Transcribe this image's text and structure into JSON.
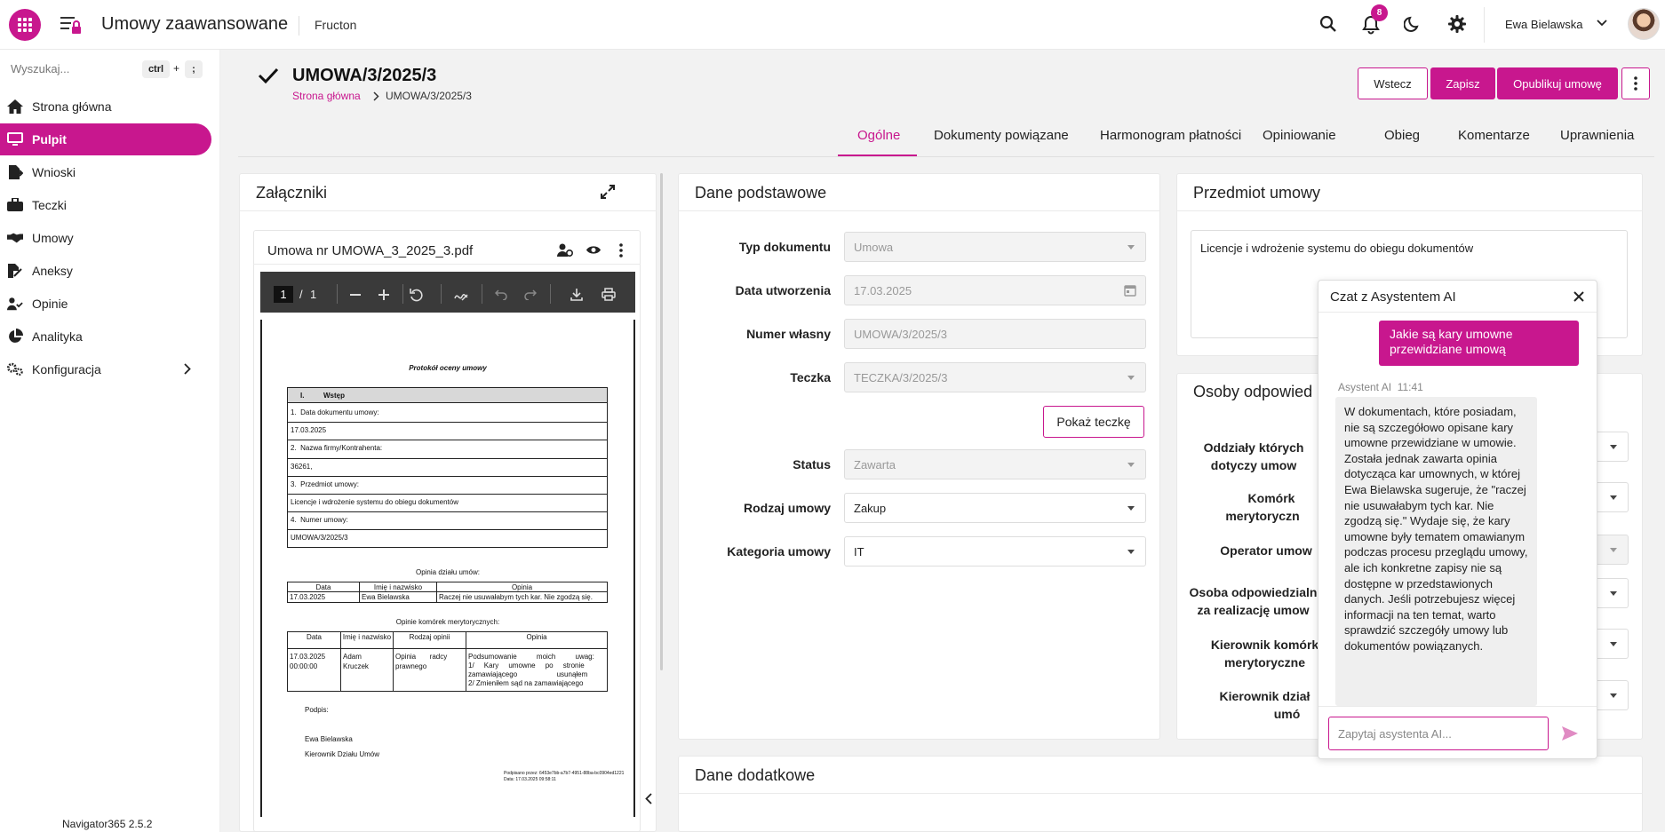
{
  "header": {
    "app_title": "Umowy zaawansowane",
    "tenant": "Fructon",
    "notifications_count": "8",
    "user_name": "Ewa Bielawska"
  },
  "sidebar": {
    "search_placeholder": "Wyszukaj...",
    "shortcut_ctrl": "ctrl",
    "shortcut_plus": "+",
    "shortcut_key": ";",
    "items": [
      {
        "label": "Strona główna",
        "icon": "home-icon"
      },
      {
        "label": "Pulpit",
        "icon": "monitor-icon",
        "active": true
      },
      {
        "label": "Wnioski",
        "icon": "file-export-icon"
      },
      {
        "label": "Teczki",
        "icon": "briefcase-icon"
      },
      {
        "label": "Umowy",
        "icon": "handshake-icon"
      },
      {
        "label": "Aneksy",
        "icon": "file-signature-icon"
      },
      {
        "label": "Opinie",
        "icon": "user-check-icon"
      },
      {
        "label": "Analityka",
        "icon": "pie-chart-icon"
      },
      {
        "label": "Konfiguracja",
        "icon": "gears-icon"
      }
    ],
    "version": "Navigator365 2.5.2"
  },
  "page": {
    "title": "UMOWA/3/2025/3",
    "breadcrumb_home": "Strona główna",
    "breadcrumb_current": "UMOWA/3/2025/3",
    "actions": {
      "back": "Wstecz",
      "save": "Zapisz",
      "publish": "Opublikuj umowę"
    }
  },
  "tabs": [
    "Ogólne",
    "Dokumenty powiązane",
    "Harmonogram płatności",
    "Opiniowanie",
    "Obieg",
    "Komentarze",
    "Uprawnienia"
  ],
  "attachments": {
    "title": "Załączniki",
    "file_name": "Umowa nr UMOWA_3_2025_3.pdf",
    "pdf_page_current": "1",
    "pdf_page_sep": "/",
    "pdf_page_total": "1",
    "pdf": {
      "heading": "Protokół oceny umowy",
      "sec_num": "I.",
      "sec_title": "Wstęp",
      "rows": [
        "1.  Data dokumentu umowy:",
        "17.03.2025",
        "2.  Nazwa firmy/Kontrahenta:",
        "36261,",
        "3.  Przedmiot umowy:",
        "Licencje i wdrożenie systemu do obiegu dokumentów",
        "4.  Numer umowy:",
        "UMOWA/3/2025/3"
      ],
      "opinion_title": "Opinia działu umów:",
      "op_headers": [
        "Data",
        "Imię i nazwisko",
        "Opinia"
      ],
      "op_row": [
        "17.03.2025",
        "Ewa Bielawska",
        "Raczej nie usuwałabym tych kar. Nie zgodzą się."
      ],
      "cells_title": "Opinie komórek merytorycznych:",
      "cell_headers": [
        "Data",
        "Imię i nazwisko",
        "Rodzaj opinii",
        "Opinia"
      ],
      "cell_date": "17.03.2025",
      "cell_time": "00:00:00",
      "cell_name1": "Adam",
      "cell_name2": "Kruczek",
      "cell_type1": "Opinia       radcy",
      "cell_type2": "prawnego",
      "cell_op1": "Podsumowanie          moich          uwag:",
      "cell_op2": "1/     Kary     umowne     po     stronie",
      "cell_op3": "zamawiającego                    usunąłem",
      "cell_op4": "2/ Zmieniłem sąd na zamawiającego",
      "sign_label": "Podpis:",
      "sign_name": "Ewa Bielawska",
      "sign_role": "Kierownik Działu Umów",
      "footer1": "Podpisano przez: 6453e7bb-a7b7-4951-88ba-bc0904ed1221",
      "footer2": "Data: 17.03.2025 09:58:11"
    }
  },
  "basic_data": {
    "title": "Dane podstawowe",
    "fields": [
      {
        "label": "Typ dokumentu",
        "value": "Umowa"
      },
      {
        "label": "Data utworzenia",
        "value": "17.03.2025"
      },
      {
        "label": "Numer własny",
        "value": "UMOWA/3/2025/3"
      },
      {
        "label": "Teczka",
        "value": "TECZKA/3/2025/3"
      },
      {
        "label": "Status",
        "value": "Zawarta"
      },
      {
        "label": "Rodzaj umowy",
        "value": "Zakup"
      },
      {
        "label": "Kategoria umowy",
        "value": "IT"
      }
    ],
    "show_folder_button": "Pokaż teczkę"
  },
  "subject": {
    "title": "Przedmiot umowy",
    "text": "Licencje i wdrożenie systemu do obiegu dokumentów"
  },
  "persons": {
    "title": "Osoby odpowied",
    "labels": [
      [
        "Oddziały których",
        "dotyczy umow"
      ],
      [
        "Komórk",
        "merytoryczn"
      ],
      [
        "Operator umow"
      ],
      [
        "Osoba odpowiedzialn",
        "za realizację umow"
      ],
      [
        "Kierownik komórk",
        "merytoryczne"
      ],
      [
        "Kierownik dział",
        "umó"
      ]
    ]
  },
  "extra": {
    "title": "Dane dodatkowe"
  },
  "chat": {
    "title": "Czat z Asystentem AI",
    "user_message": "Jakie są kary umowne przewidziane umową",
    "ai_name": "Asystent AI",
    "ai_time": "11:41",
    "ai_message": "W dokumentach, które posiadam, nie są szczegółowo opisane kary umowne przewidziane w umowie. Została jednak zawarta opinia dotycząca kar umownych, w której Ewa Bielawska sugeruje, że \"raczej nie usuwałabym tych kar. Nie zgodzą się.\" Wydaje się, że kary umowne były tematem omawianym podczas procesu przeglądu umowy, ale ich konkretne zapisy nie są dostępne w przedstawionych danych. Jeśli potrzebujesz więcej informacji na ten temat, warto sprawdzić szczegóły umowy lub dokumentów powiązanych.",
    "input_placeholder": "Zapytaj asystenta AI..."
  },
  "colors": {
    "accent": "#c8178e",
    "background": "#f2f2f2"
  }
}
